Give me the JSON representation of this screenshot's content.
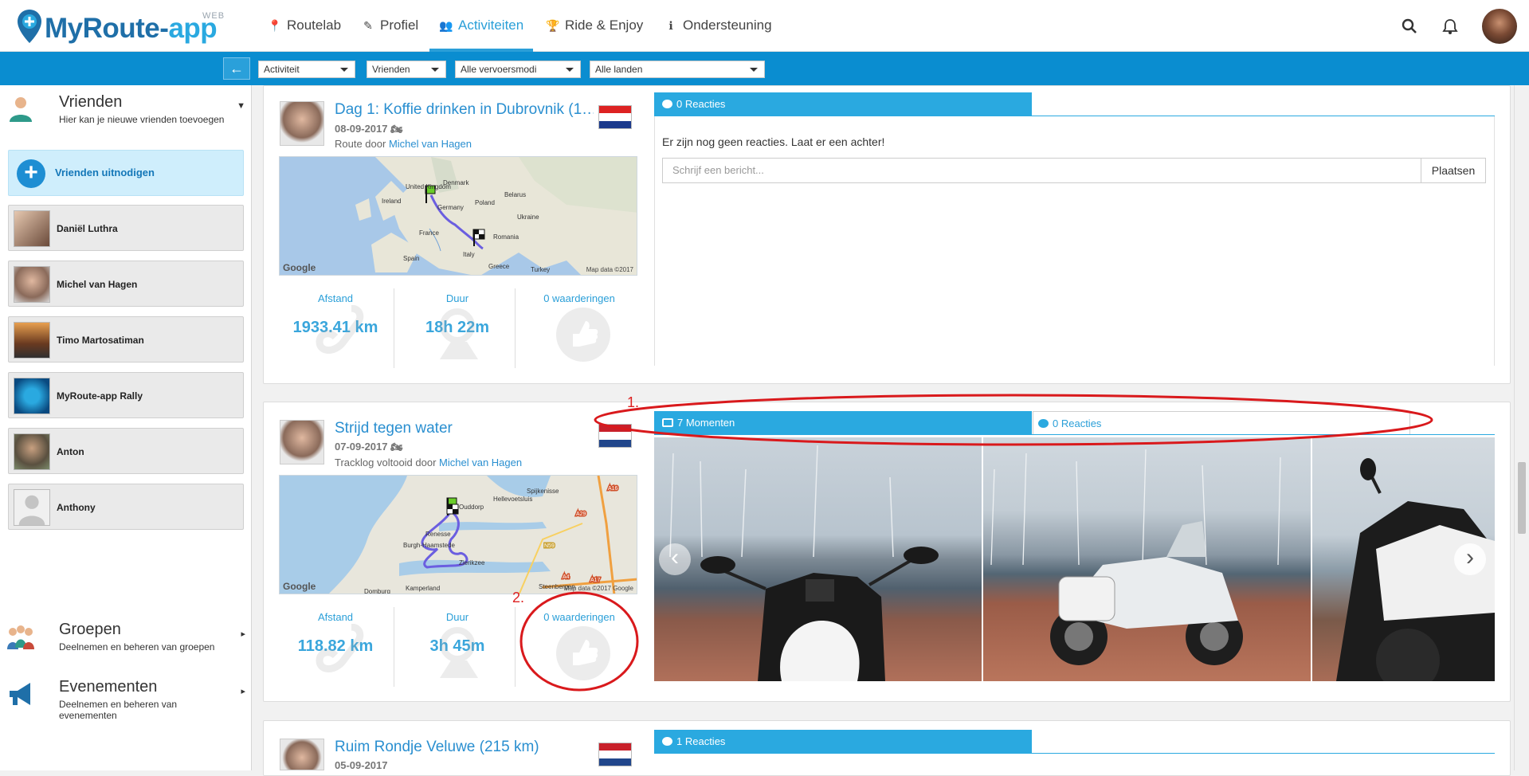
{
  "app": {
    "brand_part1": "MyRoute-",
    "brand_part2": "app",
    "badge": "WEB"
  },
  "nav": {
    "items": [
      {
        "label": "Routelab",
        "icon": "map-pin-icon"
      },
      {
        "label": "Profiel",
        "icon": "wrench-icon"
      },
      {
        "label": "Activiteiten",
        "icon": "users-icon",
        "active": true
      },
      {
        "label": "Ride & Enjoy",
        "icon": "trophy-icon"
      },
      {
        "label": "Ondersteuning",
        "icon": "info-icon"
      }
    ]
  },
  "filters": {
    "activity": "Activiteit",
    "friends": "Vrienden",
    "transport": "Alle vervoersmodi",
    "countries": "Alle landen"
  },
  "sidebar": {
    "friends_section": {
      "title": "Vrienden",
      "subtitle": "Hier kan je nieuwe vrienden toevoegen"
    },
    "invite_label": "Vrienden uitnodigen",
    "friends": [
      {
        "name": "Daniël Luthra"
      },
      {
        "name": "Michel van Hagen"
      },
      {
        "name": "Timo Martosatiman"
      },
      {
        "name": "MyRoute-app Rally"
      },
      {
        "name": "Anton"
      },
      {
        "name": "Anthony"
      }
    ],
    "groups_section": {
      "title": "Groepen",
      "subtitle": "Deelnemen en beheren van groepen"
    },
    "events_section": {
      "title": "Evenementen",
      "subtitle": "Deelnemen en beheren van evenementen"
    }
  },
  "activities": [
    {
      "title": "Dag 1: Koffie drinken in Dubrovnik (1…",
      "date": "08-09-2017",
      "route_prefix": "Route door ",
      "author": "Michel van Hagen",
      "stats": {
        "distance_label": "Afstand",
        "distance": "1933.41 km",
        "duration_label": "Duur",
        "duration": "18h 22m",
        "ratings": "0 waarderingen"
      },
      "map": {
        "labels": [
          "Ireland",
          "United Kingdom",
          "Denmark",
          "Poland",
          "Belarus",
          "Germany",
          "Ukraine",
          "France",
          "Romania",
          "Spain",
          "Italy",
          "Greece",
          "Turkey"
        ],
        "google": "Google",
        "mapdata": "Map data ©2017"
      },
      "reactions_tab": "0 Reacties",
      "empty_message": "Er zijn nog geen reacties. Laat er een achter!",
      "input_placeholder": "Schrijf een bericht...",
      "post_button": "Plaatsen"
    },
    {
      "title": "Strijd tegen water",
      "date": "07-09-2017",
      "route_prefix": "Tracklog voltooid door ",
      "author": "Michel van Hagen",
      "stats": {
        "distance_label": "Afstand",
        "distance": "118.82 km",
        "duration_label": "Duur",
        "duration": "3h 45m",
        "ratings": "0 waarderingen"
      },
      "map": {
        "labels": [
          "Spijkenisse",
          "Hellevoetsluis",
          "Ouddorp",
          "Renesse",
          "Burgh-Haamstede",
          "Zierikzee",
          "Domburg",
          "Kamperland",
          "Steenbergen",
          "A16",
          "A29",
          "N59",
          "A4",
          "A17"
        ],
        "google": "Google",
        "mapdata": "Map data ©2017 Google"
      },
      "moments_tab": "7 Momenten",
      "reactions_tab": "0 Reacties"
    },
    {
      "title": "Ruim Rondje Veluwe (215 km)",
      "date": "05-09-2017",
      "reactions_tab": "1 Reacties"
    }
  ],
  "annotations": {
    "label1": "1.",
    "label2": "2.",
    "color": "#d9191c"
  },
  "colors": {
    "accent": "#2aa9e0",
    "filterbar": "#0a8dd0"
  }
}
